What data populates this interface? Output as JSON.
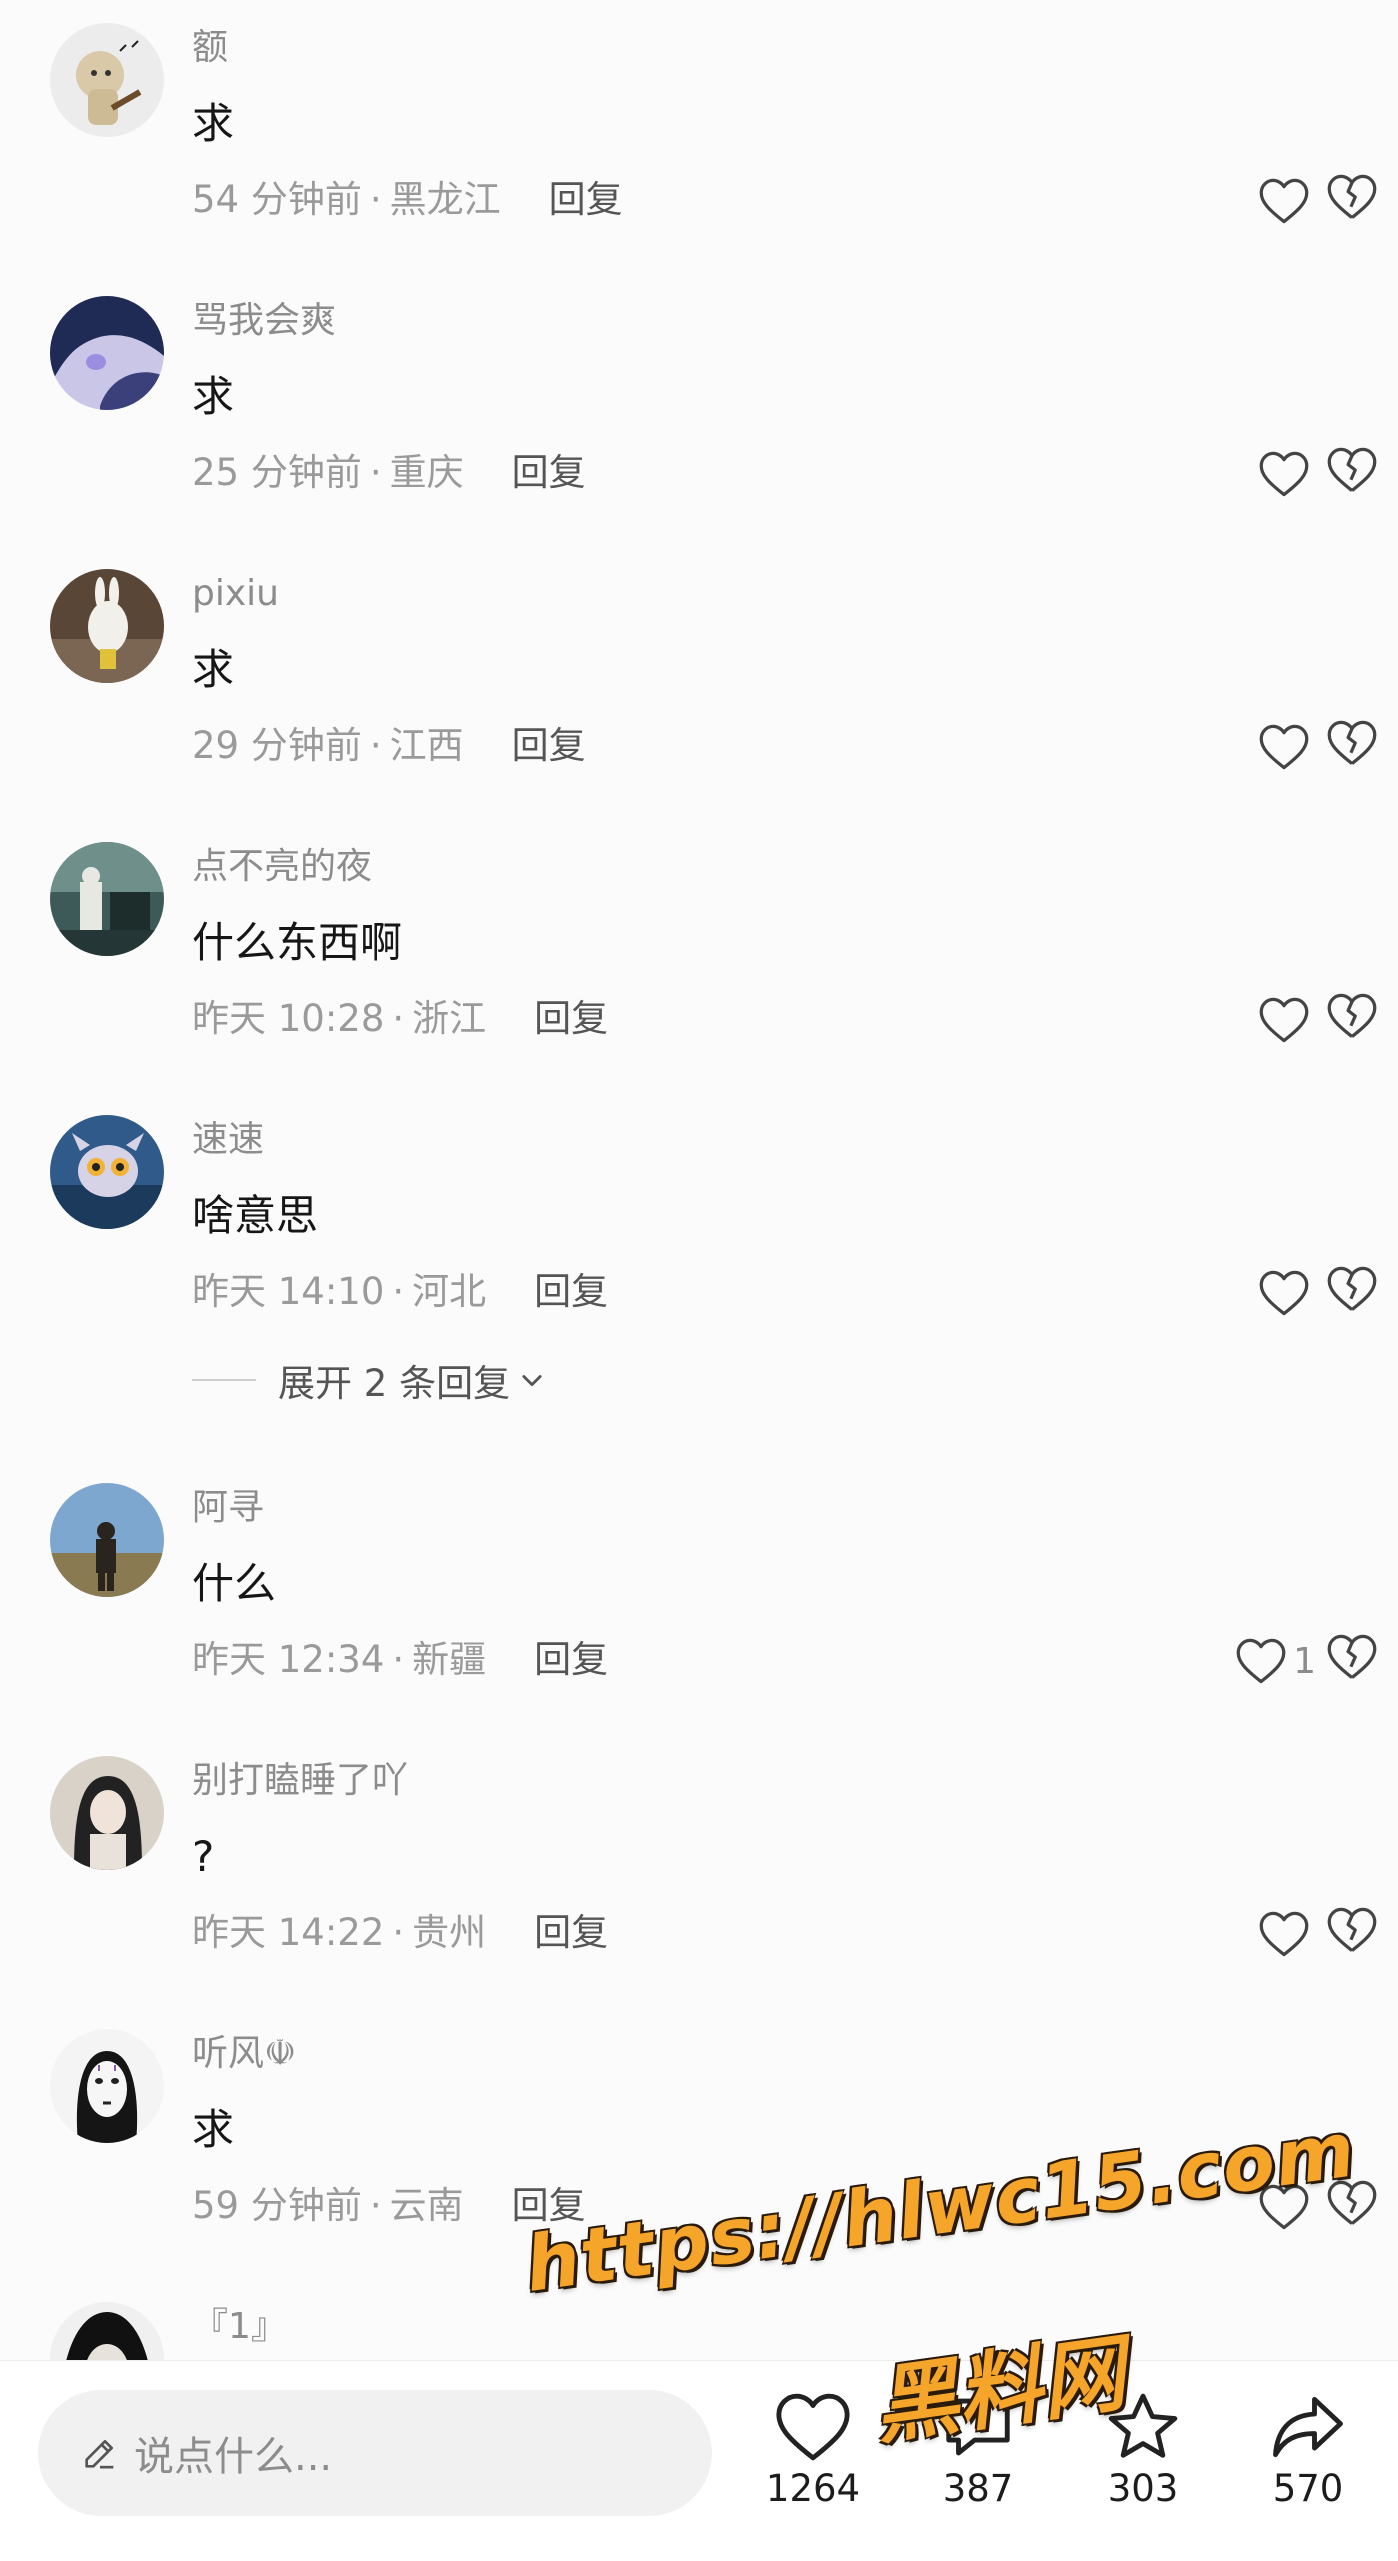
{
  "comments": [
    {
      "user": "额",
      "text": "求",
      "time": "54 分钟前",
      "loc": "黑龙江",
      "likes": ""
    },
    {
      "user": "骂我会爽",
      "text": "求",
      "time": "25 分钟前",
      "loc": "重庆",
      "likes": ""
    },
    {
      "user": "pixiu",
      "text": "求",
      "time": "29 分钟前",
      "loc": "江西",
      "likes": ""
    },
    {
      "user": "点不亮的夜",
      "text": "什么东西啊",
      "time": "昨天 10:28",
      "loc": "浙江",
      "likes": ""
    },
    {
      "user": "速速",
      "text": "啥意思",
      "time": "昨天 14:10",
      "loc": "河北",
      "likes": ""
    },
    {
      "user": "阿寻",
      "text": "什么",
      "time": "昨天 12:34",
      "loc": "新疆",
      "likes": "1"
    },
    {
      "user": "别打瞌睡了吖",
      "text": "?",
      "time": "昨天 14:22",
      "loc": "贵州",
      "likes": ""
    },
    {
      "user": "听风☫",
      "text": "求",
      "time": "59 分钟前",
      "loc": "云南",
      "likes": ""
    },
    {
      "user": "『1』",
      "text": "",
      "time": "",
      "loc": "",
      "likes": ""
    }
  ],
  "reply_label": "回复",
  "dot": "·",
  "expand_label": "展开 2 条回复",
  "input_placeholder": "说点什么...",
  "actions": {
    "like_count": "1264",
    "comment_count": "387",
    "star_count": "303",
    "share_count": "570"
  },
  "watermark": {
    "url": "https://hlwc15.com",
    "name": "黑料网",
    "color": "#f5a52a"
  },
  "icons": {
    "like": "heart-outline-icon",
    "dislike": "broken-heart-icon",
    "pencil": "pencil-icon",
    "star": "star-outline-icon",
    "share": "share-arrow-icon"
  }
}
